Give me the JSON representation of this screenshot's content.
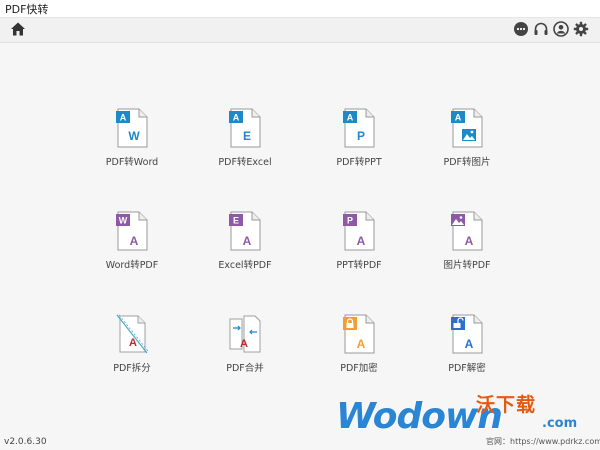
{
  "window": {
    "title": "PDF快转"
  },
  "toolbar": {
    "home_icon": "home-icon",
    "right_icons": [
      "chat-icon",
      "headset-icon",
      "user-icon",
      "gear-icon"
    ]
  },
  "colors": {
    "to_pdf_blue": "#1e88c8",
    "from_pdf_purple": "#8e5aa8",
    "tool_gray": "#a0a0a0",
    "encrypt_orange": "#f0a030",
    "decrypt_blue": "#2d6fd0",
    "pdf_red": "#c0272d"
  },
  "tools": [
    {
      "label": "PDF转Word",
      "letter": "W"
    },
    {
      "label": "PDF转Excel",
      "letter": "E"
    },
    {
      "label": "PDF转PPT",
      "letter": "P"
    },
    {
      "label": "PDF转图片",
      "letter": ""
    },
    {
      "label": "Word转PDF",
      "letter": "W"
    },
    {
      "label": "Excel转PDF",
      "letter": "E"
    },
    {
      "label": "PPT转PDF",
      "letter": "P"
    },
    {
      "label": "图片转PDF",
      "letter": ""
    },
    {
      "label": "PDF拆分",
      "letter": ""
    },
    {
      "label": "PDF合并",
      "letter": ""
    },
    {
      "label": "PDF加密",
      "letter": ""
    },
    {
      "label": "PDF解密",
      "letter": ""
    }
  ],
  "footer": {
    "version": "v2.0.6.30"
  },
  "watermark": {
    "word": "Wodown",
    "cn": "沃下载",
    "com": ".com",
    "url": "官网：https://www.pdrkz.com"
  }
}
